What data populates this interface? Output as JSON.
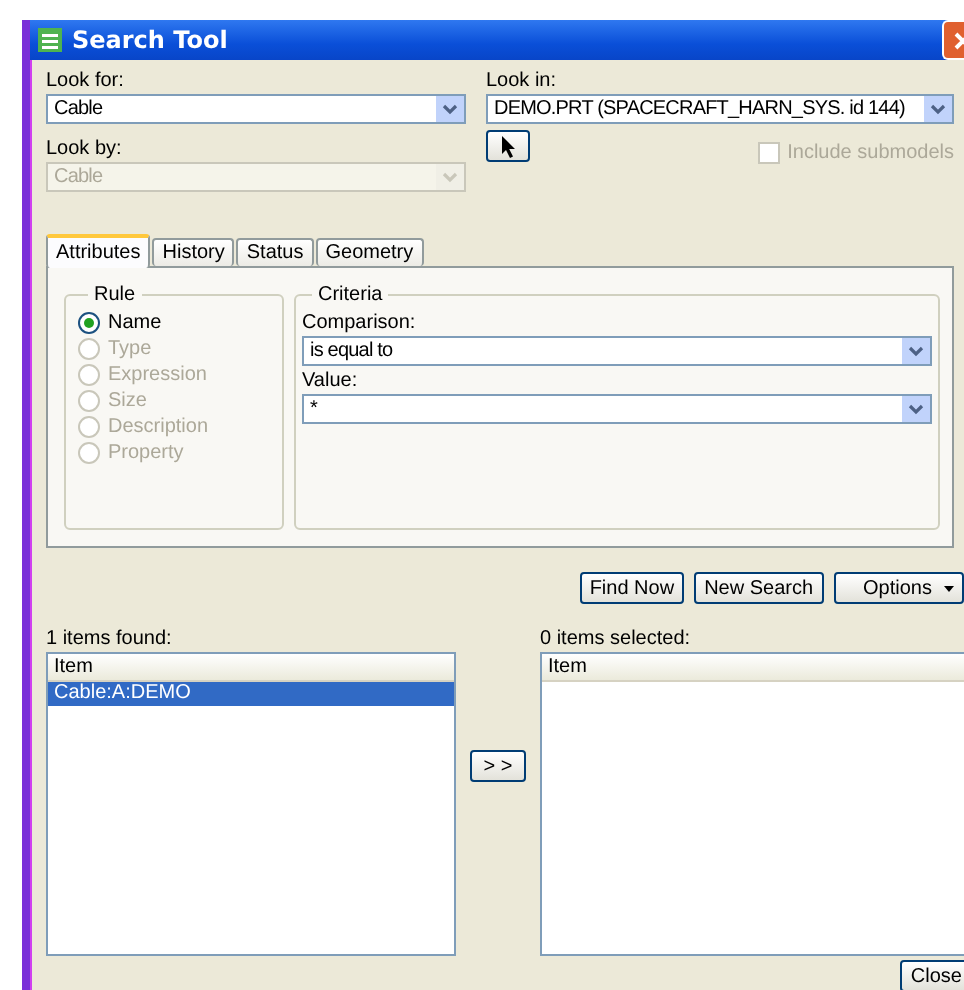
{
  "window": {
    "title": "Search Tool"
  },
  "look_for": {
    "label": "Look for:",
    "value": "Cable"
  },
  "look_by": {
    "label": "Look by:",
    "value": "Cable",
    "disabled": true
  },
  "look_in": {
    "label": "Look in:",
    "value": "DEMO.PRT (SPACECRAFT_HARN_SYS. id 144)"
  },
  "include_submodels": {
    "label": "Include submodels",
    "checked": false,
    "disabled": true
  },
  "tabs": [
    {
      "label": "Attributes",
      "selected": true
    },
    {
      "label": "History",
      "selected": false
    },
    {
      "label": "Status",
      "selected": false
    },
    {
      "label": "Geometry",
      "selected": false
    }
  ],
  "rule": {
    "title": "Rule",
    "options": [
      {
        "label": "Name",
        "selected": true,
        "disabled": false
      },
      {
        "label": "Type",
        "selected": false,
        "disabled": true
      },
      {
        "label": "Expression",
        "selected": false,
        "disabled": true
      },
      {
        "label": "Size",
        "selected": false,
        "disabled": true
      },
      {
        "label": "Description",
        "selected": false,
        "disabled": true
      },
      {
        "label": "Property",
        "selected": false,
        "disabled": true
      }
    ]
  },
  "criteria": {
    "title": "Criteria",
    "comparison": {
      "label": "Comparison:",
      "value": "is equal to"
    },
    "value": {
      "label": "Value:",
      "value": "*"
    }
  },
  "buttons": [
    {
      "label": "Find Now",
      "kind": "plain"
    },
    {
      "label": "New Search",
      "kind": "plain"
    },
    {
      "label": "Options",
      "kind": "menu"
    }
  ],
  "found": {
    "label": "1 items found:",
    "column": "Item",
    "items": [
      {
        "text": "Cable:A:DEMO",
        "selected": true
      }
    ]
  },
  "move_button": {
    "label": "> >"
  },
  "selected_list": {
    "label": "0 items selected:",
    "column": "Item"
  },
  "close_button": {
    "label": "Close"
  }
}
